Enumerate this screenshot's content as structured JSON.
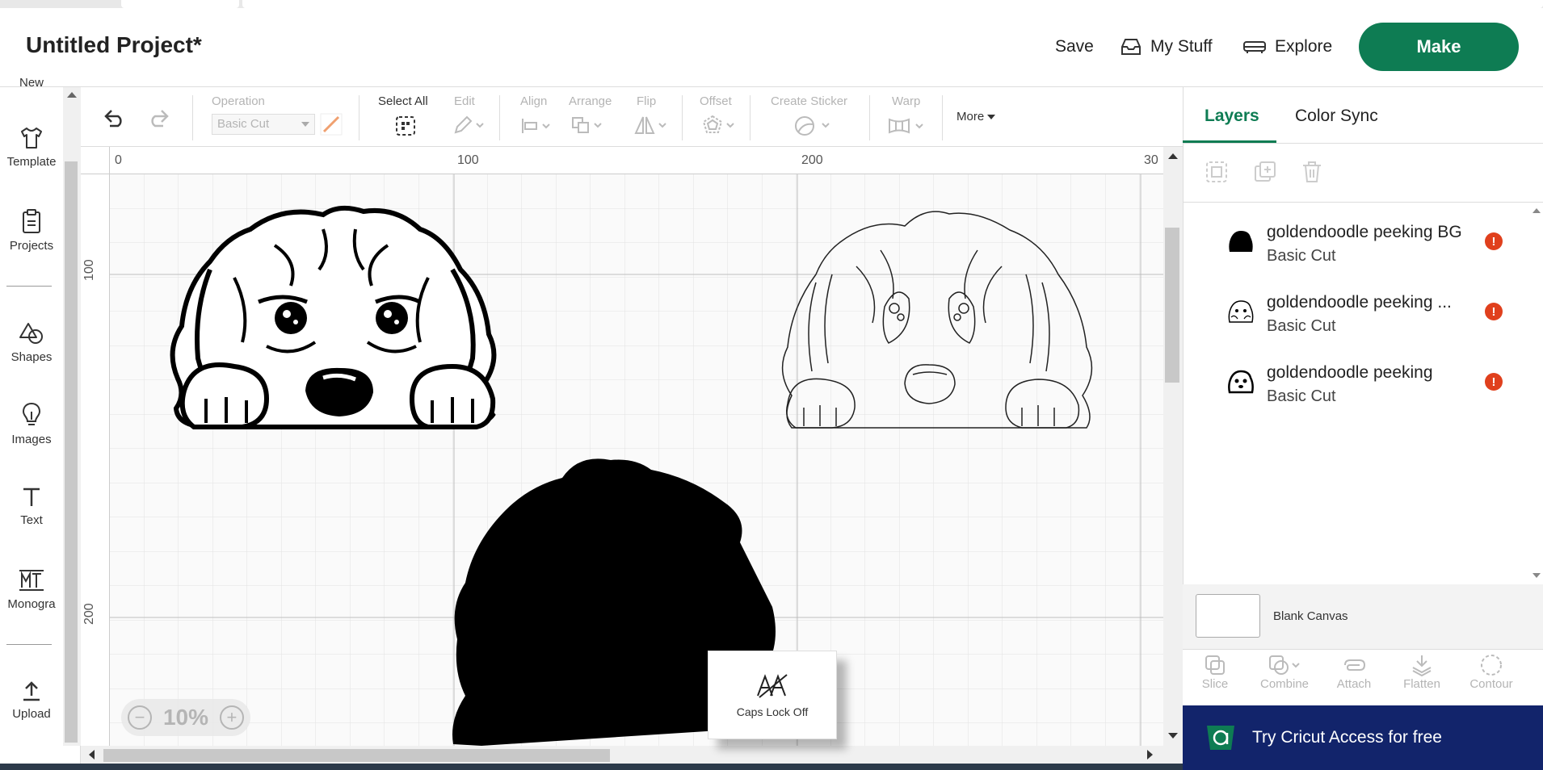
{
  "header": {
    "project_title": "Untitled Project*",
    "save_label": "Save",
    "my_stuff_label": "My Stuff",
    "explore_label": "Explore",
    "make_label": "Make"
  },
  "sidebar": {
    "items": [
      {
        "label": "New",
        "icon": "new-icon"
      },
      {
        "label": "Template",
        "icon": "shirt-icon"
      },
      {
        "label": "Projects",
        "icon": "clipboard-icon"
      },
      {
        "label": "Shapes",
        "icon": "shapes-icon"
      },
      {
        "label": "Images",
        "icon": "lightbulb-icon"
      },
      {
        "label": "Text",
        "icon": "text-icon"
      },
      {
        "label": "Monogra",
        "icon": "monogram-icon"
      },
      {
        "label": "Upload",
        "icon": "upload-icon"
      }
    ]
  },
  "toolbar": {
    "operation_label": "Operation",
    "operation_value": "Basic Cut",
    "select_all_label": "Select All",
    "edit_label": "Edit",
    "align_label": "Align",
    "arrange_label": "Arrange",
    "flip_label": "Flip",
    "offset_label": "Offset",
    "create_sticker_label": "Create Sticker",
    "warp_label": "Warp",
    "more_label": "More"
  },
  "canvas": {
    "ruler_top": [
      "0",
      "100",
      "200",
      "30"
    ],
    "ruler_left": [
      "100",
      "200"
    ],
    "zoom": "10%",
    "caps_lock": "Caps Lock Off"
  },
  "panel": {
    "tabs": [
      "Layers",
      "Color Sync"
    ],
    "layers": [
      {
        "name": "goldendoodle peeking BG",
        "operation": "Basic Cut",
        "warning": "!"
      },
      {
        "name": "goldendoodle peeking ...",
        "operation": "Basic Cut",
        "warning": "!"
      },
      {
        "name": "goldendoodle peeking",
        "operation": "Basic Cut",
        "warning": "!"
      }
    ],
    "blank_canvas_label": "Blank Canvas",
    "bottom_tools": [
      "Slice",
      "Combine",
      "Attach",
      "Flatten",
      "Contour"
    ],
    "promo": "Try Cricut Access for free"
  },
  "colors": {
    "brand_green": "#0e7c53",
    "promo_navy": "#12246b",
    "warning_red": "#e0401d"
  }
}
